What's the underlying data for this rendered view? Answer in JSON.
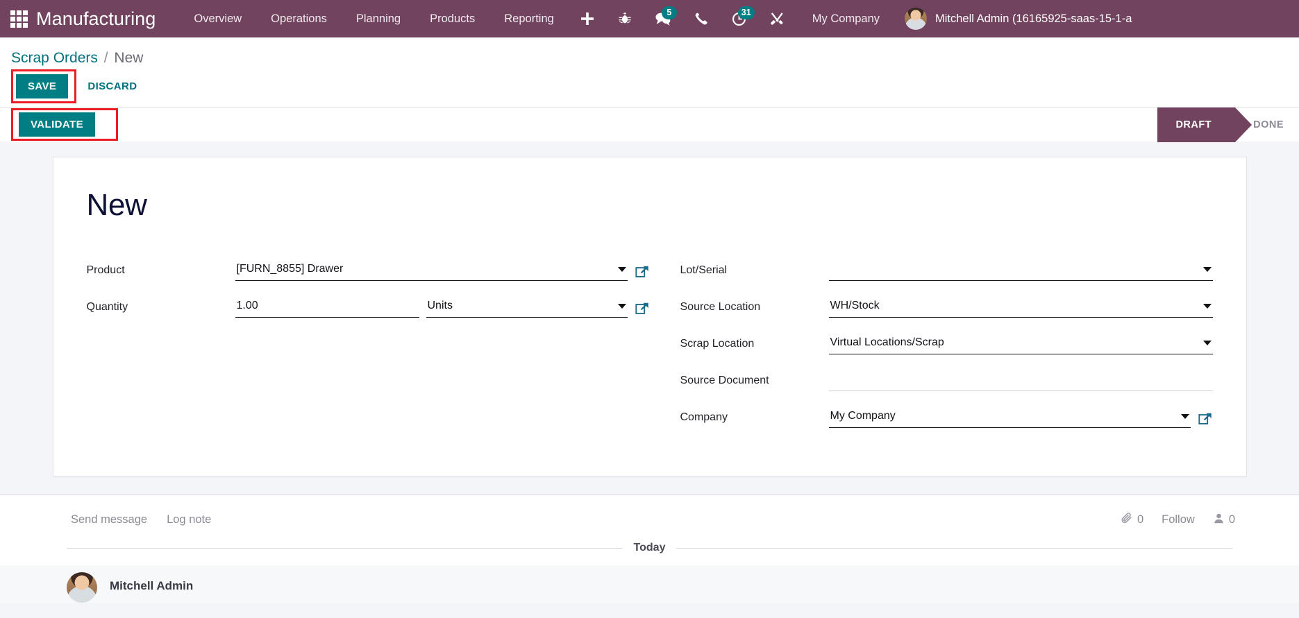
{
  "navbar": {
    "apps_icon": "apps-grid-icon",
    "brand": "Manufacturing",
    "menu": [
      {
        "label": "Overview"
      },
      {
        "label": "Operations"
      },
      {
        "label": "Planning"
      },
      {
        "label": "Products"
      },
      {
        "label": "Reporting"
      }
    ],
    "icons": [
      {
        "name": "plus-icon",
        "badge": ""
      },
      {
        "name": "bug-icon",
        "badge": ""
      },
      {
        "name": "messages-icon",
        "badge": "5"
      },
      {
        "name": "phone-icon",
        "badge": ""
      },
      {
        "name": "activity-clock-icon",
        "badge": "31"
      },
      {
        "name": "tools-icon",
        "badge": ""
      }
    ],
    "company": "My Company",
    "user_name": "Mitchell Admin (16165925-saas-15-1-a",
    "background_color": "#71435f",
    "badge_color": "#017e84"
  },
  "breadcrumb": {
    "parent": "Scrap Orders",
    "separator": "/",
    "current": "New"
  },
  "toolbar": {
    "save_label": "SAVE",
    "discard_label": "DISCARD",
    "validate_label": "VALIDATE",
    "primary_color": "#017e84",
    "highlight_color": "#ec1c24"
  },
  "statusbar": {
    "steps": [
      {
        "label": "DRAFT",
        "active": true
      },
      {
        "label": "DONE",
        "active": false
      }
    ],
    "active_color": "#71435f"
  },
  "form": {
    "title": "New",
    "left_fields": [
      {
        "label": "Product",
        "value": "[FURN_8855] Drawer",
        "has_caret": true,
        "has_ext_link": true
      }
    ],
    "quantity": {
      "label": "Quantity",
      "value": "1.00",
      "uom": "Units"
    },
    "right_fields": [
      {
        "label": "Lot/Serial",
        "value": "",
        "has_caret": true,
        "has_ext_link": false,
        "faint": false
      },
      {
        "label": "Source Location",
        "value": "WH/Stock",
        "has_caret": true,
        "has_ext_link": false,
        "faint": false
      },
      {
        "label": "Scrap Location",
        "value": "Virtual Locations/Scrap",
        "has_caret": true,
        "has_ext_link": false,
        "faint": false
      },
      {
        "label": "Source Document",
        "value": "",
        "has_caret": false,
        "has_ext_link": false,
        "faint": true
      },
      {
        "label": "Company",
        "value": "My Company",
        "has_caret": true,
        "has_ext_link": true,
        "faint": false
      }
    ]
  },
  "chatter": {
    "send_message_label": "Send message",
    "log_note_label": "Log note",
    "attachment_icon": "paperclip-icon",
    "attachment_count": "0",
    "follow_label": "Follow",
    "followers_icon": "user-icon",
    "followers_count": "0",
    "today_label": "Today",
    "messages": [
      {
        "author": "Mitchell Admin"
      }
    ]
  }
}
